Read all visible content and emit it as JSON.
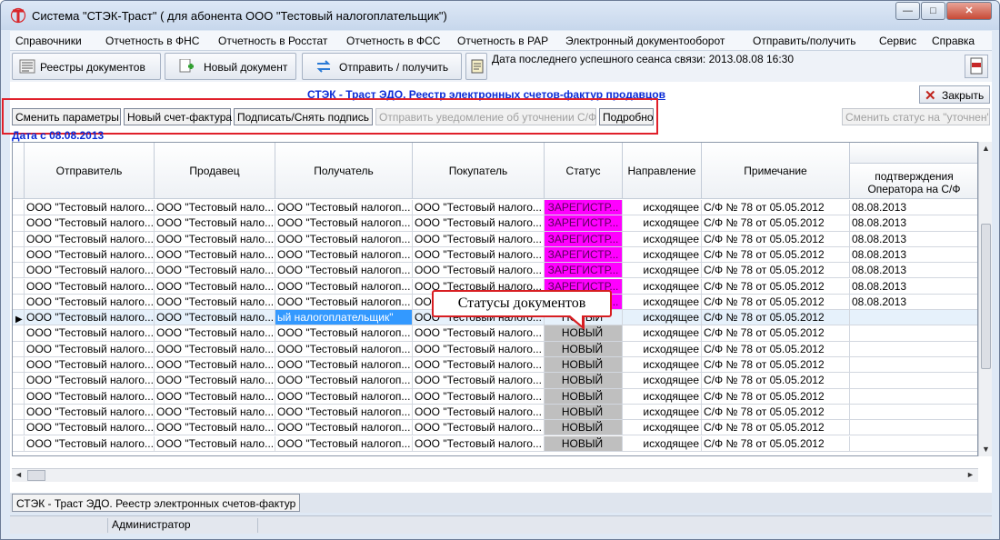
{
  "window": {
    "title": "Система \"СТЭК-Траст\" ( для абонента ООО \"Тестовый налогоплательщик\")",
    "min_label": "—",
    "max_label": "□",
    "close_label": "✕"
  },
  "menu": [
    "Справочники",
    "Отчетность в ФНС",
    "Отчетность в Росстат",
    "Отчетность в ФСС",
    "Отчетность в РАР",
    "Электронный документооборот",
    "Отправить/получить",
    "Сервис",
    "Справка"
  ],
  "toolbar": {
    "registers": "Реестры документов",
    "new_doc": "Новый документ",
    "send_receive": "Отправить / получить",
    "last_session": "Дата последнего успешного сеанса связи: 2013.08.08 16:30"
  },
  "form": {
    "title": "СТЭК - Траст ЭДО. Реестр электронных счетов-фактур продавцов",
    "close": "Закрыть",
    "actions": [
      "Сменить параметры",
      "Новый счет-фактура",
      "Подписать/Снять подпись",
      "Отправить уведомление об уточнении С/Ф",
      "Подробно"
    ],
    "change_status": "Сменить статус на \"уточнен\"",
    "date_from": "Дата с 08.08.2013"
  },
  "table": {
    "columns": [
      "Отправитель",
      "Продавец",
      "Получатель",
      "Покупатель",
      "Статус",
      "Направление",
      "Примечание",
      "подтверждения Оператора на С/Ф"
    ],
    "rows": [
      {
        "sender": "ООО \"Тестовый налого...",
        "seller": "ООО \"Тестовый нало...",
        "recipient": "ООО \"Тестовый налогоп...",
        "buyer": "ООО \"Тестовый налого...",
        "status": "ЗАРЕГИСТР...",
        "direction": "исходящее",
        "note": "С/Ф № 78 от 05.05.2012",
        "confirm": "08.08.2013"
      },
      {
        "sender": "ООО \"Тестовый налого...",
        "seller": "ООО \"Тестовый нало...",
        "recipient": "ООО \"Тестовый налогоп...",
        "buyer": "ООО \"Тестовый налого...",
        "status": "ЗАРЕГИСТР...",
        "direction": "исходящее",
        "note": "С/Ф № 78 от 05.05.2012",
        "confirm": "08.08.2013"
      },
      {
        "sender": "ООО \"Тестовый налого...",
        "seller": "ООО \"Тестовый нало...",
        "recipient": "ООО \"Тестовый налогоп...",
        "buyer": "ООО \"Тестовый налого...",
        "status": "ЗАРЕГИСТР...",
        "direction": "исходящее",
        "note": "С/Ф № 78 от 05.05.2012",
        "confirm": "08.08.2013"
      },
      {
        "sender": "ООО \"Тестовый налого...",
        "seller": "ООО \"Тестовый нало...",
        "recipient": "ООО \"Тестовый налогоп...",
        "buyer": "ООО \"Тестовый налого...",
        "status": "ЗАРЕГИСТР...",
        "direction": "исходящее",
        "note": "С/Ф № 78 от 05.05.2012",
        "confirm": "08.08.2013"
      },
      {
        "sender": "ООО \"Тестовый налого...",
        "seller": "ООО \"Тестовый нало...",
        "recipient": "ООО \"Тестовый налогоп...",
        "buyer": "ООО \"Тестовый налого...",
        "status": "ЗАРЕГИСТР...",
        "direction": "исходящее",
        "note": "С/Ф № 78 от 05.05.2012",
        "confirm": "08.08.2013"
      },
      {
        "sender": "ООО \"Тестовый налого...",
        "seller": "ООО \"Тестовый нало...",
        "recipient": "ООО \"Тестовый налогоп...",
        "buyer": "ООО \"Тестовый налого...",
        "status": "ЗАРЕГИСТР...",
        "direction": "исходящее",
        "note": "С/Ф № 78 от 05.05.2012",
        "confirm": "08.08.2013"
      },
      {
        "sender": "ООО \"Тестовый налого...",
        "seller": "ООО \"Тестовый нало...",
        "recipient": "ООО \"Тестовый налогоп...",
        "buyer": "ООО \"Тестовый налого...",
        "status": "ЗАРЕГИСТР...",
        "direction": "исходящее",
        "note": "С/Ф № 78 от 05.05.2012",
        "confirm": "08.08.2013"
      },
      {
        "sender": "ООО \"Тестовый налого...",
        "seller": "ООО \"Тестовый нало...",
        "recipient": "ый налогоплательщик\"",
        "buyer": "ООО \"Тестовый налого...",
        "status": "НОВЫЙ",
        "direction": "исходящее",
        "note": "С/Ф № 78 от 05.05.2012",
        "confirm": ""
      },
      {
        "sender": "ООО \"Тестовый налого...",
        "seller": "ООО \"Тестовый нало...",
        "recipient": "ООО \"Тестовый налогоп...",
        "buyer": "ООО \"Тестовый налого...",
        "status": "НОВЫЙ",
        "direction": "исходящее",
        "note": "С/Ф № 78 от 05.05.2012",
        "confirm": ""
      },
      {
        "sender": "ООО \"Тестовый налого...",
        "seller": "ООО \"Тестовый нало...",
        "recipient": "ООО \"Тестовый налогоп...",
        "buyer": "ООО \"Тестовый налого...",
        "status": "НОВЫЙ",
        "direction": "исходящее",
        "note": "С/Ф № 78 от 05.05.2012",
        "confirm": ""
      },
      {
        "sender": "ООО \"Тестовый налого...",
        "seller": "ООО \"Тестовый нало...",
        "recipient": "ООО \"Тестовый налогоп...",
        "buyer": "ООО \"Тестовый налого...",
        "status": "НОВЫЙ",
        "direction": "исходящее",
        "note": "С/Ф № 78 от 05.05.2012",
        "confirm": ""
      },
      {
        "sender": "ООО \"Тестовый налого...",
        "seller": "ООО \"Тестовый нало...",
        "recipient": "ООО \"Тестовый налогоп...",
        "buyer": "ООО \"Тестовый налого...",
        "status": "НОВЫЙ",
        "direction": "исходящее",
        "note": "С/Ф № 78 от 05.05.2012",
        "confirm": ""
      },
      {
        "sender": "ООО \"Тестовый налого...",
        "seller": "ООО \"Тестовый нало...",
        "recipient": "ООО \"Тестовый налогоп...",
        "buyer": "ООО \"Тестовый налого...",
        "status": "НОВЫЙ",
        "direction": "исходящее",
        "note": "С/Ф № 78 от 05.05.2012",
        "confirm": ""
      },
      {
        "sender": "ООО \"Тестовый налого...",
        "seller": "ООО \"Тестовый нало...",
        "recipient": "ООО \"Тестовый налогоп...",
        "buyer": "ООО \"Тестовый налого...",
        "status": "НОВЫЙ",
        "direction": "исходящее",
        "note": "С/Ф № 78 от 05.05.2012",
        "confirm": ""
      },
      {
        "sender": "ООО \"Тестовый налого...",
        "seller": "ООО \"Тестовый нало...",
        "recipient": "ООО \"Тестовый налогоп...",
        "buyer": "ООО \"Тестовый налого...",
        "status": "НОВЫЙ",
        "direction": "исходящее",
        "note": "С/Ф № 78 от 05.05.2012",
        "confirm": ""
      },
      {
        "sender": "ООО \"Тестовый налого...",
        "seller": "ООО \"Тестовый нало...",
        "recipient": "ООО \"Тестовый налогоп...",
        "buyer": "ООО \"Тестовый налого...",
        "status": "НОВЫЙ",
        "direction": "исходящее",
        "note": "С/Ф № 78 от 05.05.2012",
        "confirm": ""
      }
    ],
    "current_row": 7
  },
  "callout": "Статусы документов",
  "tab": "СТЭК - Траст ЭДО. Реестр электронных счетов-фактур",
  "statusbar": {
    "user": "Администратор"
  },
  "colors": {
    "status_registered": "#ff00ff",
    "status_new": "#bfbfbf",
    "title_blue": "#0b2bd6",
    "highlight_red": "#e0202a"
  }
}
